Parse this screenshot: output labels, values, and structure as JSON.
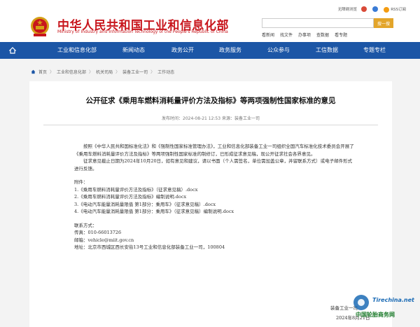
{
  "header": {
    "site_title": "中华人民共和国工业和信息化部",
    "site_title_en": "Ministry of Industry and Information Technology of the People's Republic of China",
    "top_links": [
      "无障碍浏览",
      "",
      "",
      "RSS订阅"
    ],
    "search_button": "搜一搜",
    "hot_links": [
      "看新闻",
      "找文件",
      "办事项",
      "查数据",
      "看专题"
    ]
  },
  "nav": {
    "items": [
      "工业和信息化部",
      "新闻动态",
      "政务公开",
      "政务服务",
      "公众参与",
      "工信数据",
      "专题专栏"
    ]
  },
  "breadcrumb": [
    "首页",
    "工业和信息化部",
    "机关司局",
    "装备工业一司",
    "工作动态"
  ],
  "article": {
    "title": "公开征求《乘用车燃料消耗量评价方法及指标》等两项强制性国家标准的意见",
    "meta": "发布时间：2024-08-21 12:53    来源：装备工业一司",
    "para1": "按照《中华人民共和国标准化法》和《强制性国家标准管理办法》，工业和信息化部装备工业一司组织全国汽车标准化技术委员会开展了《乘用车燃料消耗量评价方法及指标》等两项强制性国家标准的制修订，已形成征求意见稿，现公开征求社会各界意见。",
    "para2": "征求意见截止日期为2024年10月20日，如有意见和建议，请以书面（个人需签名，单位需加盖公章，并留联系方式）或电子邮件形式进行反馈。",
    "attach_label": "附件：",
    "attachments": [
      "1.《乘用车燃料消耗量评价方法及指标》（征求意见稿）.docx",
      "2.《乘用车燃料消耗量评价方法及指标》编制说明.docx",
      "3.《电动汽车能量消耗量限值 第1部分：乘用车》（征求意见稿）.docx",
      "4.《电动汽车能量消耗量限值 第1部分：乘用车》（征求意见稿）编制说明.docx"
    ],
    "contact_label": "联系方式：",
    "fax": "传真：010-66013726",
    "email": "邮箱：vehicle@miit.gov.cn",
    "address": "地址：北京市西城区西长安街13号工业和信息化部装备工业一司，100804",
    "signature": "装备工业一司",
    "sign_date": "2024年8月21日"
  },
  "watermark": {
    "logo": "Tirechina.net",
    "text": "中国轮胎商务网"
  },
  "colors": {
    "brand_red": "#c8161d",
    "nav_blue": "#1c56a6",
    "search_btn": "#e3a52a"
  }
}
